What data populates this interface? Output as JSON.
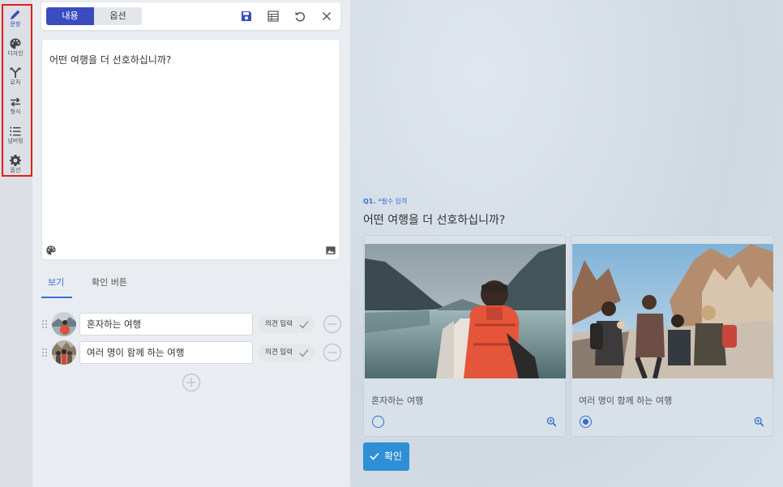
{
  "sidebar": {
    "items": [
      {
        "label": "문항",
        "icon": "pencil-icon"
      },
      {
        "label": "디자인",
        "icon": "palette-icon"
      },
      {
        "label": "로직",
        "icon": "logic-fork-icon"
      },
      {
        "label": "형식",
        "icon": "swap-arrows-icon"
      },
      {
        "label": "넘버링",
        "icon": "numbered-list-icon"
      },
      {
        "label": "옵션",
        "icon": "gear-icon"
      }
    ],
    "active_index": 0
  },
  "toolbar": {
    "segments": [
      "내용",
      "옵션"
    ],
    "active_segment": 0,
    "icons": [
      "save-icon",
      "table-icon",
      "undo-icon",
      "close-icon"
    ]
  },
  "editor": {
    "question_text": "어떤 여행을 더 선호하십니까?",
    "icons": [
      "palette-icon",
      "image-icon"
    ]
  },
  "option_tabs": [
    "보기",
    "확인 버튼"
  ],
  "options": [
    {
      "label": "혼자하는 여행",
      "badge": "의견 입력"
    },
    {
      "label": "여러 명이 함께 하는 여행",
      "badge": "의견 입력"
    }
  ],
  "preview": {
    "question_number": "Q1.",
    "required_text": "*필수 입력",
    "question_title": "어떤 여행을 더 선호하십니까?",
    "choices": [
      {
        "label": "혼자하는 여행",
        "selected": false
      },
      {
        "label": "여러 명이 함께 하는 여행",
        "selected": true
      }
    ],
    "confirm_label": "확인"
  },
  "colors": {
    "accent": "#3b4cc0",
    "link_blue": "#3b6fd6",
    "confirm_button": "#2f8fd6",
    "highlight_border": "#e0201b"
  }
}
